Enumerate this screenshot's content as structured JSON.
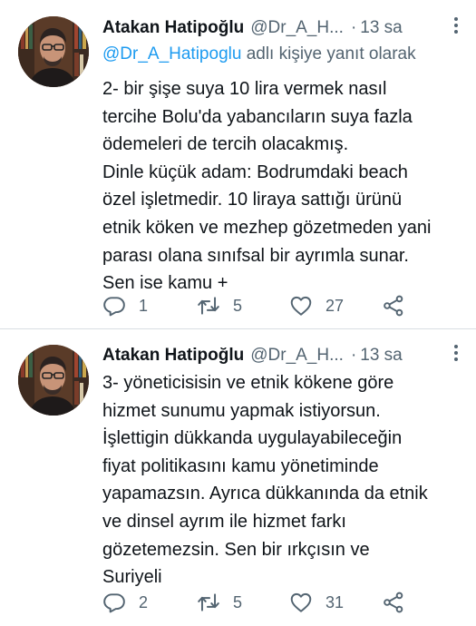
{
  "tweets": [
    {
      "author_name": "Atakan Hatipoğlu",
      "author_handle": "@Dr_A_H...",
      "separator": "·",
      "time": "13 sa",
      "reply_to_mention": "@Dr_A_Hatipoglu",
      "reply_to_suffix": " adlı kişiye yanıt olarak",
      "lines": [
        "2- bir şişe suya 10 lira vermek nasıl",
        "tercihe Bolu'da yabancıların suya fazla",
        "ödemeleri de tercih olacakmış.",
        "Dinle küçük adam: Bodrumdaki beach",
        "özel işletmedir. 10 liraya sattığı ürünü",
        "etnik köken ve mezhep gözetmeden yani",
        "parası olana sınıfsal bir ayrımla sunar.",
        "Sen ise kamu +"
      ],
      "replies": "1",
      "retweets": "5",
      "likes": "27"
    },
    {
      "author_name": "Atakan Hatipoğlu",
      "author_handle": "@Dr_A_H...",
      "separator": "·",
      "time": "13 sa",
      "lines": [
        "3- yöneticisisin ve etnik kökene göre",
        "hizmet sunumu yapmak istiyorsun.",
        "İşlettigin dükkanda uygulayabileceğin",
        "fiyat politikasını kamu yönetiminde",
        "yapamazsın. Ayrıca dükkanında da etnik",
        "ve dinsel ayrım ile hizmet farkı",
        "gözetemezsin.  Sen bir ırkçısın ve",
        "Suriyeli"
      ],
      "replies": "2",
      "retweets": "5",
      "likes": "31"
    }
  ],
  "icons": {
    "reply": "reply-icon",
    "retweet": "retweet-icon",
    "like": "heart-icon",
    "share": "share-icon",
    "more": "more-icon"
  },
  "colors": {
    "text": "#0f1419",
    "secondary": "#536471",
    "mention": "#1d9bf0",
    "divider": "#d8dee3"
  }
}
